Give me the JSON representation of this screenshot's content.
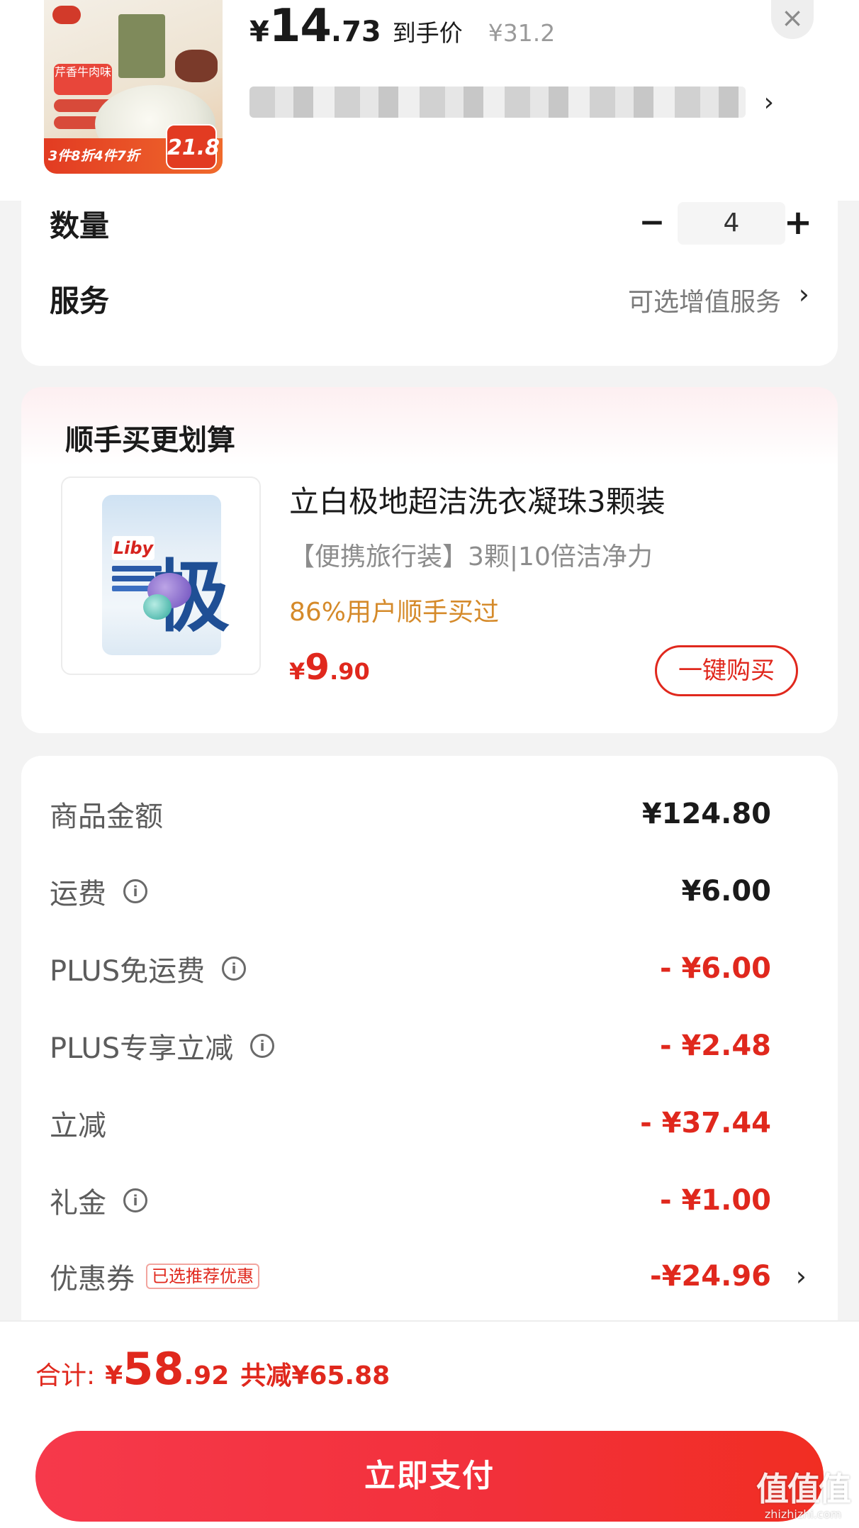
{
  "header": {
    "currency": "¥",
    "price_int": "14",
    "price_dec": ".73",
    "price_label": "到手价",
    "original_price": "¥31.2",
    "close_symbol": "×",
    "thumb": {
      "flavor_text": "芹香牛肉味",
      "promo_text": "3件8折4件7折",
      "promo_price": "21.8"
    }
  },
  "options": {
    "quantity_label": "数量",
    "quantity_value": "4",
    "minus_symbol": "−",
    "plus_symbol": "+",
    "service_label": "服务",
    "service_value": "可选增值服务"
  },
  "recommend": {
    "title": "顺手买更划算",
    "product_name": "立白极地超洁洗衣凝珠3颗装",
    "product_desc": "【便携旅行装】3颗|10倍洁净力",
    "social_proof": "86%用户顺手买过",
    "currency": "¥",
    "price_int": "9",
    "price_dec": ".90",
    "buy_button": "一键购买",
    "pack_brand": "Liby",
    "pack_big_char": "极"
  },
  "summary": {
    "rows": [
      {
        "label": "商品金额",
        "value": "¥124.80",
        "info": false
      },
      {
        "label": "运费",
        "value": "¥6.00",
        "info": true
      },
      {
        "label": "PLUS免运费",
        "value": "- ¥6.00",
        "info": true
      },
      {
        "label": "PLUS专享立减",
        "value": "- ¥2.48",
        "info": true
      },
      {
        "label": "立减",
        "value": "- ¥37.44",
        "info": false
      },
      {
        "label": "礼金",
        "value": "- ¥1.00",
        "info": true
      },
      {
        "label": "优惠券",
        "value": "-¥24.96",
        "info": false,
        "tag": "已选推荐优惠"
      }
    ],
    "info_symbol": "i"
  },
  "total": {
    "label": "合计:",
    "currency": "¥",
    "int": "58",
    "dec": ".92",
    "saved": "共减¥65.88"
  },
  "pay_button": "立即支付",
  "watermark": {
    "logo": "值值值",
    "url": "zhizhizhi.com"
  },
  "icons": {
    "chevron": "›"
  },
  "colors": {
    "accent_red": "#e0281d",
    "social_orange": "#d58a2a",
    "pay_gradient_start": "#f6394b",
    "pay_gradient_end": "#f12e22"
  }
}
